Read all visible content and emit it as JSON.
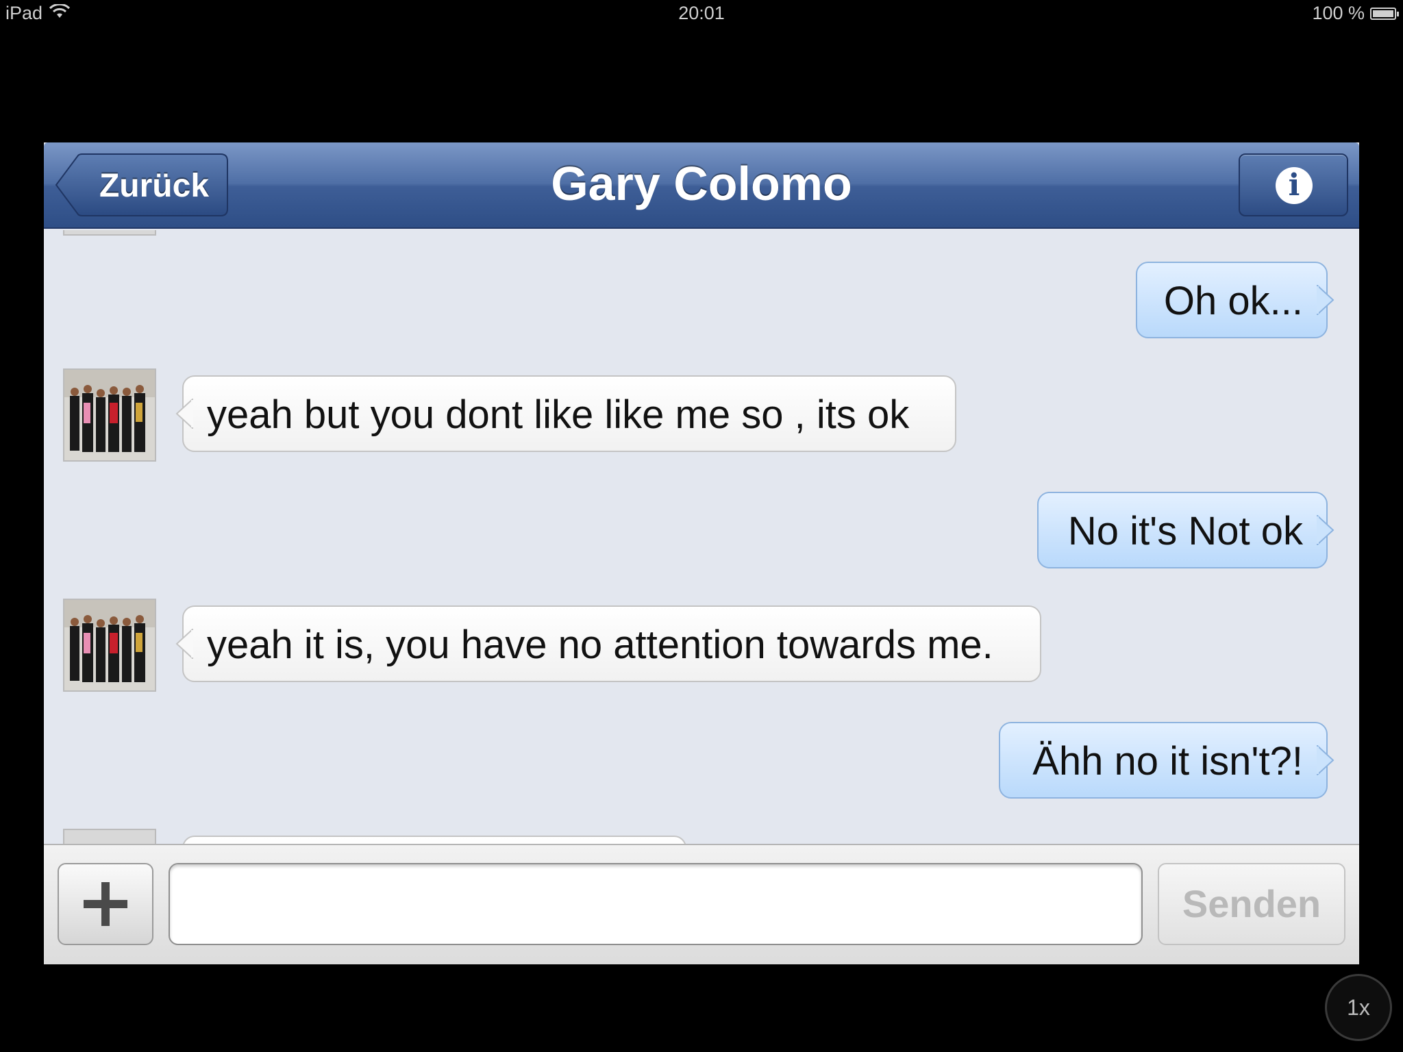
{
  "status_bar": {
    "device": "iPad",
    "time": "20:01",
    "battery": "100 %"
  },
  "navbar": {
    "back_label": "Zurück",
    "title": "Gary Colomo"
  },
  "messages": [
    {
      "direction": "outgoing",
      "text": "Oh ok..."
    },
    {
      "direction": "incoming",
      "text": "yeah but you dont like like me so , its ok"
    },
    {
      "direction": "outgoing",
      "text": "No it's Not ok"
    },
    {
      "direction": "incoming",
      "text": "yeah it is, you have no attention towards me."
    },
    {
      "direction": "outgoing",
      "text": "Ähh no it isn't?!"
    }
  ],
  "input": {
    "value": "",
    "send_label": "Senden"
  },
  "zoom_indicator": "1x",
  "colors": {
    "navbar": "#3e5e97",
    "outgoing_bubble": "#c7e0fb",
    "incoming_bubble": "#ffffff",
    "background": "#e3e7ef"
  }
}
